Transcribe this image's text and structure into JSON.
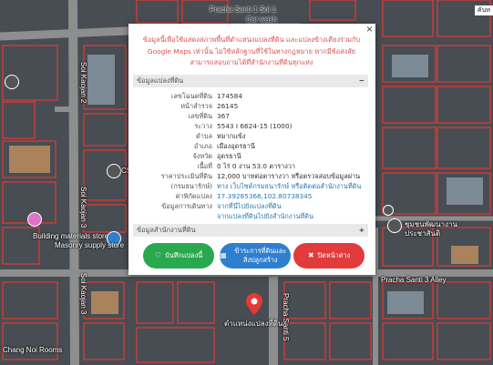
{
  "map": {
    "corner_label": "คันห",
    "streets": {
      "soi1": "Pracha Santi 1 Soi 1",
      "carwash": "Car wash",
      "soi2": "Soi Kaojan 2",
      "soi3": "Soi Kaojan 3",
      "soi3b": "Soi Kaojan 3",
      "alley": "Pracha Santi 3 Alley",
      "santi5": "Pracha Santi 5"
    },
    "pois": {
      "cs": "CS Pla",
      "building": "Building materials store",
      "masonry": "Masonry supply store",
      "chang": "Chang Noi Rooms",
      "community": "ชุมชนพัฒนางาน",
      "community2": "ประชาสันติ"
    },
    "marker_label": "ตำแหน่งแปลงที่ดิน"
  },
  "popup": {
    "close_symbol": "×",
    "notice": "ข้อมูลนี้เพื่อใช้แสดงสภาพพื้นที่ตำแหน่งแปลงที่ดิน และแปลงข้างเคียงร่วมกับ Google Maps เท่านั้น ไม่ใช้หลักฐานที่ใช้ในทางกฎหมาย หากมีข้อสงสัยสามารถสอบถามได้ที่สำนักงานที่ดินทุกแห่ง",
    "section1": {
      "title": "ข้อมูลแปลงที่ดิน",
      "toggle": "−"
    },
    "rows": [
      {
        "label": "เลขโฉนดที่ดิน",
        "value": "174584"
      },
      {
        "label": "หน้าสำรวจ",
        "value": "26145"
      },
      {
        "label": "เลขที่ดิน",
        "value": "367"
      },
      {
        "label": "ระวาง",
        "value": "5543 I 6624-15 (1000)"
      },
      {
        "label": "ตำบล",
        "value": "หมากแข้ง"
      },
      {
        "label": "อำเภอ",
        "value": "เมืองอุดรธานี"
      },
      {
        "label": "จังหวัด",
        "value": "อุดรธานี"
      },
      {
        "label": "เนื้อที่",
        "value": "0 ไร่ 0 งาน 53.0 ตารางวา"
      },
      {
        "label": "ราคาประเมินที่ดิน",
        "value": "12,000 บาทต่อตารางวา หรือตรวจสอบข้อมูลผ่าน"
      },
      {
        "label": "(กรมธนารักษ์)",
        "value": "ทาง เว็บไซต์กรมธนารักษ์ หรือติดต่อสำนักงานที่ดิน"
      },
      {
        "label": "ค่าพิกัดแปลง",
        "value": "17.39285366,102.80738345"
      },
      {
        "label": "ข้อมูลการเดินทาง",
        "value": "จากที่นี่ไปยังแปลงที่ดิน"
      },
      {
        "label": "",
        "value": "จากแปลงที่ดินไปยังสำนักงานที่ดิน"
      }
    ],
    "section2": {
      "title": "ข้อมูลสำนักงานที่ดิน",
      "toggle": "+"
    },
    "buttons": {
      "save": "บันทึกแปลงนี้",
      "info": "ข้าระการที่ดินและ สิ่งปลูกสร้าง",
      "close": "ปิดหน้าต่าง"
    }
  }
}
